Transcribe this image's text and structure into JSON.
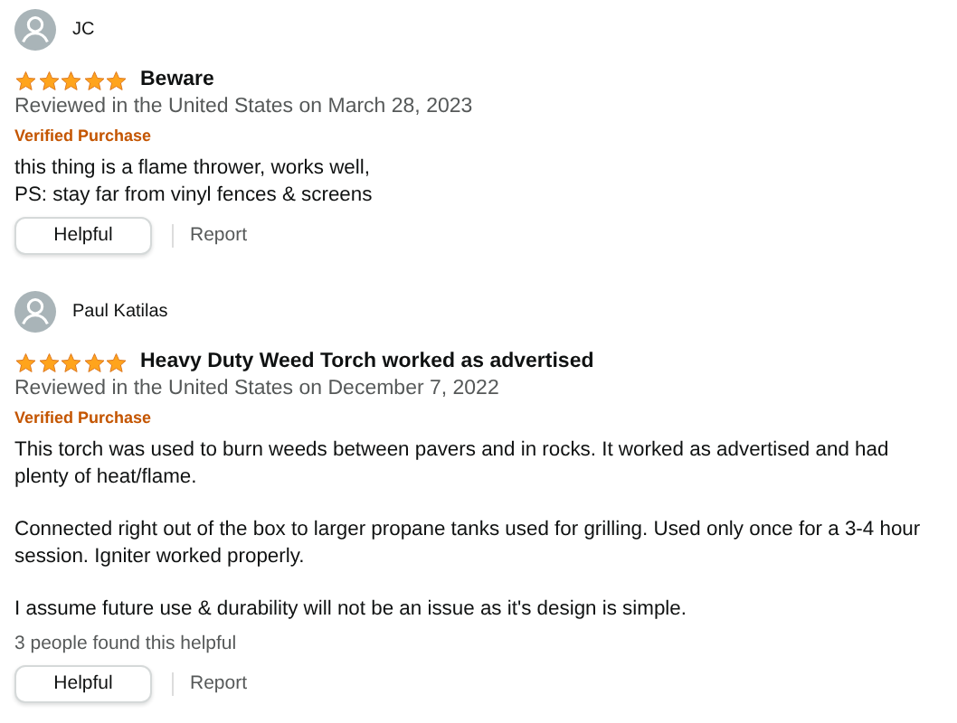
{
  "reviews": [
    {
      "author": "JC",
      "stars": 5,
      "title": "Beware",
      "date": "Reviewed in the United States on March 28, 2023",
      "verified": "Verified Purchase",
      "paragraphs": [
        "this thing is a flame thrower, works well,\nPS: stay far from vinyl fences & screens"
      ],
      "helpful_button": "Helpful",
      "report": "Report"
    },
    {
      "author": "Paul Katilas",
      "stars": 5,
      "title": "Heavy Duty Weed Torch worked as advertised",
      "date": "Reviewed in the United States on December 7, 2022",
      "verified": "Verified Purchase",
      "paragraphs": [
        "This torch was used to burn weeds between pavers and in rocks. It worked as advertised and had plenty of heat/flame.",
        "Connected right out of the box to larger propane tanks used for grilling. Used only once for a 3-4 hour session. Igniter worked properly.",
        "I assume future use & durability will not be an issue as it's design is simple."
      ],
      "helpful_count": "3 people found this helpful",
      "helpful_button": "Helpful",
      "report": "Report"
    }
  ]
}
